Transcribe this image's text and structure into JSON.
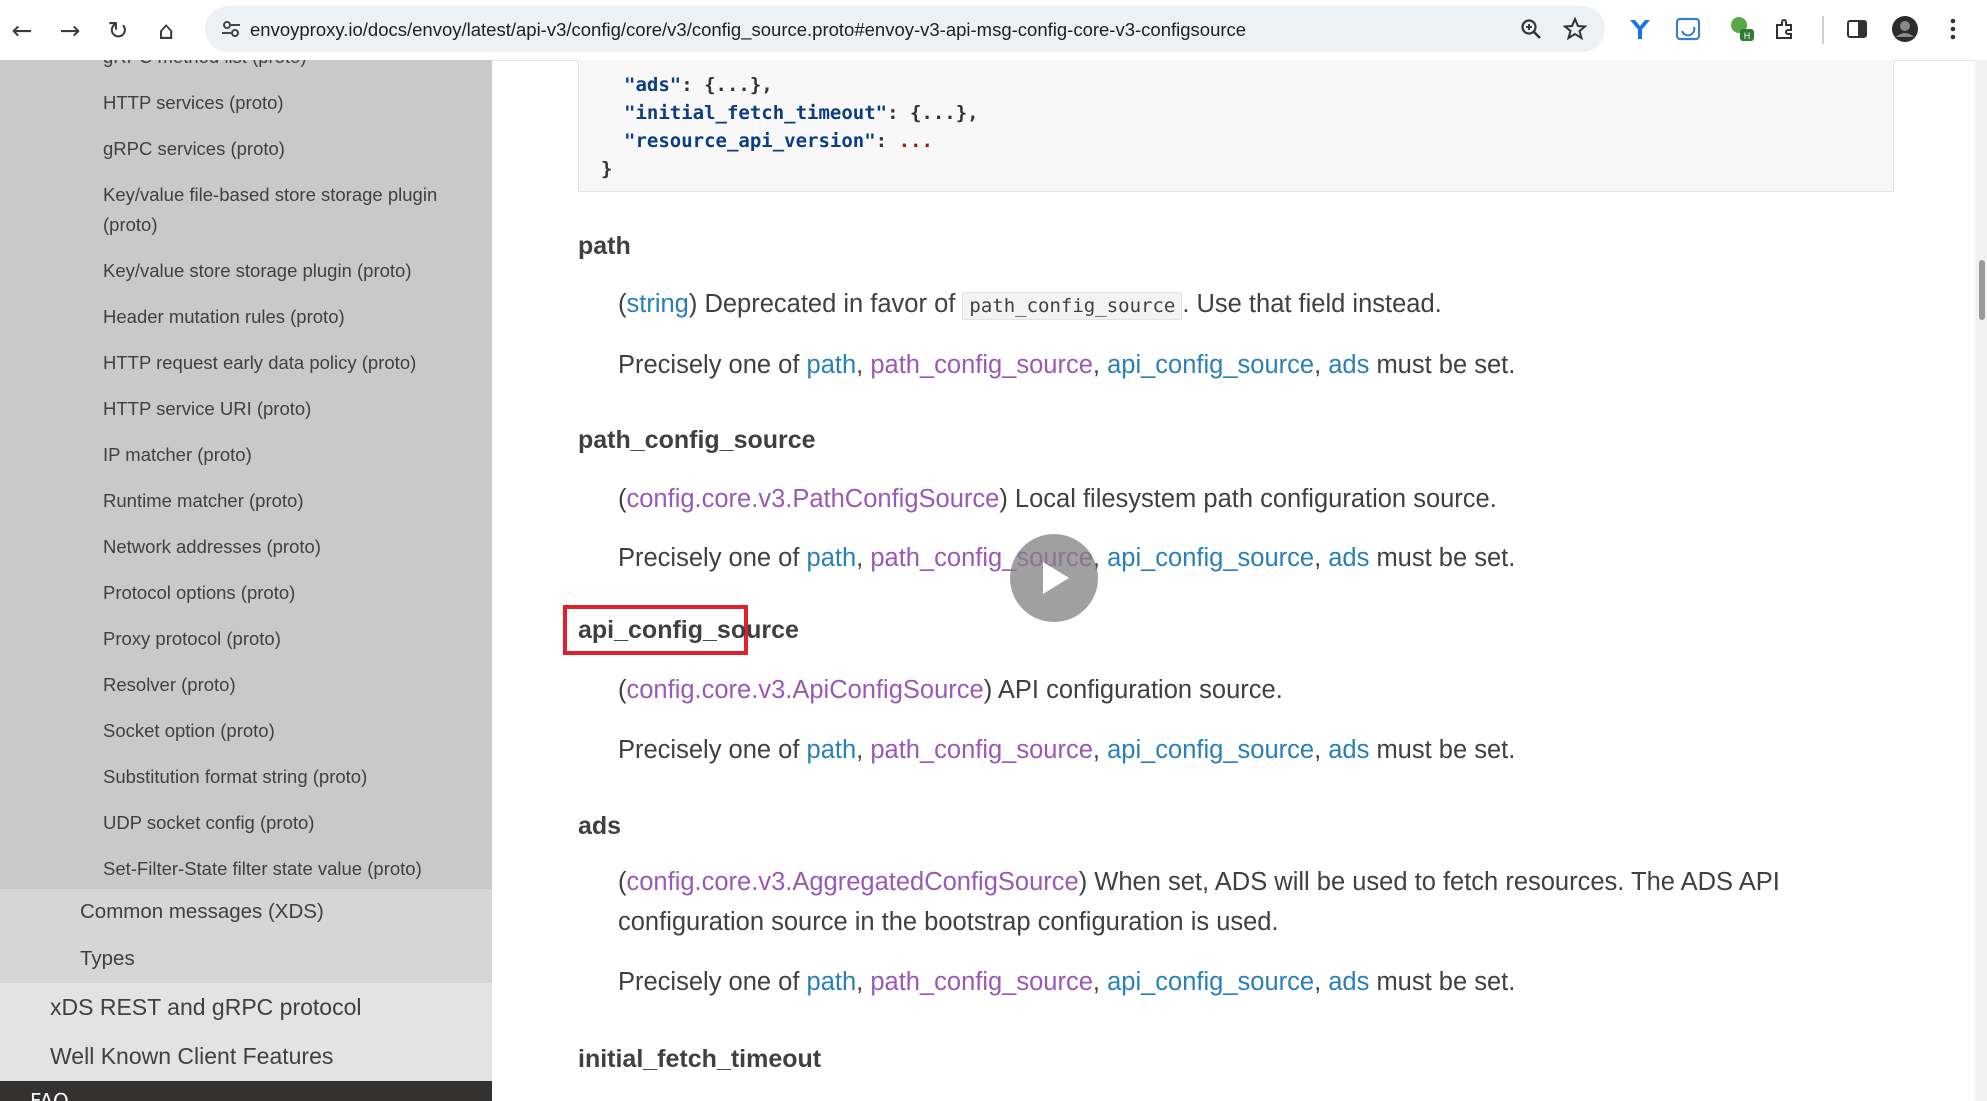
{
  "browser": {
    "url": "envoyproxy.io/docs/envoy/latest/api-v3/config/core/v3/config_source.proto#envoy-v3-api-msg-config-core-v3-configsource",
    "nav": {
      "back": "←",
      "forward": "→",
      "reload": "↻",
      "home": "⌂"
    }
  },
  "sidebar": {
    "partial_top": "gRPC method list (proto)",
    "items": [
      "HTTP services (proto)",
      "gRPC services (proto)",
      "Key/value file-based store storage plugin (proto)",
      "Key/value store storage plugin (proto)",
      "Header mutation rules (proto)",
      "HTTP request early data policy (proto)",
      "HTTP service URI (proto)",
      "IP matcher (proto)",
      "Runtime matcher (proto)",
      "Network addresses (proto)",
      "Protocol options (proto)",
      "Proxy protocol (proto)",
      "Resolver (proto)",
      "Socket option (proto)",
      "Substitution format string (proto)",
      "UDP socket config (proto)",
      "Set-Filter-State filter state value (proto)"
    ],
    "level2": [
      "Common messages (XDS)",
      "Types"
    ],
    "level1": [
      "xDS REST and gRPC protocol",
      "Well Known Client Features"
    ],
    "dark_item": "FAQ"
  },
  "code": {
    "line1_key": "\"ads\"",
    "line1_rest": ": {...},",
    "line2_key": "\"initial_fetch_timeout\"",
    "line2_rest": ": {...},",
    "line3_key": "\"resource_api_version\"",
    "line3_colon": ": ",
    "line3_val": "...",
    "line4": "}"
  },
  "common": {
    "precisely": "Precisely one of ",
    "comma": ", ",
    "must": " must be set.",
    "opts": [
      "path",
      "path_config_source",
      "api_config_source",
      "ads"
    ]
  },
  "fields": {
    "path": {
      "name": "path",
      "type": "string",
      "desc_a": " Deprecated in favor of ",
      "code": "path_config_source",
      "desc_b": ". Use that field instead."
    },
    "path_config_source": {
      "name": "path_config_source",
      "type": "config.core.v3.PathConfigSource",
      "desc": " Local filesystem path configuration source."
    },
    "api_config_source": {
      "name": "api_config_source",
      "type": "config.core.v3.ApiConfigSource",
      "desc": " API configuration source."
    },
    "ads": {
      "name": "ads",
      "type": "config.core.v3.AggregatedConfigSource",
      "desc": " When set, ADS will be used to fetch resources. The ADS API configuration source in the bootstrap configuration is used."
    },
    "initial_fetch_timeout": {
      "name": "initial_fetch_timeout"
    }
  },
  "paren_open": "(",
  "paren_close": ")",
  "colors": {
    "link": "#2980b9",
    "visited": "#9b59b6",
    "highlight": "#e0202a"
  }
}
